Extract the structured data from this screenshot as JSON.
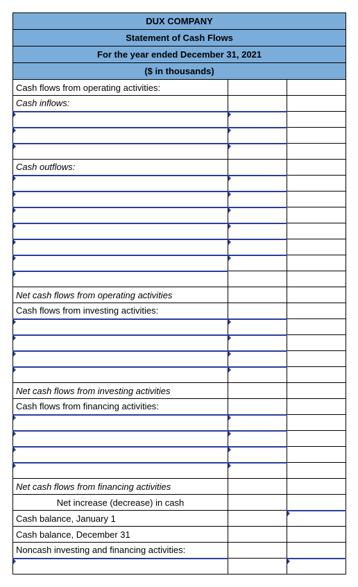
{
  "header": {
    "company": "DUX COMPANY",
    "title": "Statement of Cash Flows",
    "period": "For the year ended December 31, 2021",
    "units": "($ in thousands)"
  },
  "rows": [
    {
      "label": "Cash flows from operating activities:",
      "style": "",
      "c1": "plain",
      "c2": "plain"
    },
    {
      "label": "Cash inflows:",
      "style": "ital",
      "c1": "plain",
      "c2": "plain"
    },
    {
      "label": "",
      "style": "in indent-1",
      "c1": "in",
      "c2": "plain"
    },
    {
      "label": "",
      "style": "in indent-1",
      "c1": "in",
      "c2": "plain"
    },
    {
      "label": "",
      "style": "in indent-1",
      "c1": "in",
      "c2": "plain"
    },
    {
      "label": "Cash outflows:",
      "style": "ital",
      "c1": "plain",
      "c2": "plain"
    },
    {
      "label": "",
      "style": "in indent-1",
      "c1": "in",
      "c2": "plain"
    },
    {
      "label": "",
      "style": "in indent-1",
      "c1": "in",
      "c2": "plain"
    },
    {
      "label": "",
      "style": "in indent-1",
      "c1": "in",
      "c2": "plain"
    },
    {
      "label": "",
      "style": "in indent-1",
      "c1": "in",
      "c2": "plain"
    },
    {
      "label": "",
      "style": "in indent-1",
      "c1": "in",
      "c2": "plain"
    },
    {
      "label": "",
      "style": "in indent-1",
      "c1": "in",
      "c2": "plain"
    },
    {
      "label": "",
      "style": "in indent-1",
      "c1": "plain",
      "c2": "plain"
    },
    {
      "label": "Net cash flows from operating activities",
      "style": "ital",
      "c1": "plain",
      "c2": "plain"
    },
    {
      "label": "Cash flows from investing activities:",
      "style": "",
      "c1": "plain",
      "c2": "plain"
    },
    {
      "label": "",
      "style": "in indent-1",
      "c1": "in",
      "c2": "plain"
    },
    {
      "label": "",
      "style": "in indent-1",
      "c1": "in",
      "c2": "plain"
    },
    {
      "label": "",
      "style": "in indent-1",
      "c1": "in",
      "c2": "plain"
    },
    {
      "label": "",
      "style": "in indent-1",
      "c1": "in",
      "c2": "plain"
    },
    {
      "label": "Net cash flows from investing activities",
      "style": "ital",
      "c1": "plain",
      "c2": "plain"
    },
    {
      "label": "Cash flows from financing activities:",
      "style": "",
      "c1": "plain",
      "c2": "plain"
    },
    {
      "label": "",
      "style": "in indent-1",
      "c1": "in",
      "c2": "plain"
    },
    {
      "label": "",
      "style": "in indent-1",
      "c1": "in",
      "c2": "plain"
    },
    {
      "label": "",
      "style": "in indent-1",
      "c1": "in",
      "c2": "plain"
    },
    {
      "label": "",
      "style": "in indent-1",
      "c1": "in",
      "c2": "plain"
    },
    {
      "label": "Net cash flows from financing activities",
      "style": "ital",
      "c1": "plain",
      "c2": "plain"
    },
    {
      "label": "Net increase (decrease) in cash",
      "style": "indent-center",
      "c1": "plain",
      "c2": "plain"
    },
    {
      "label": "Cash balance, January 1",
      "style": "",
      "c1": "plain",
      "c2": "in"
    },
    {
      "label": "Cash balance, December 31",
      "style": "",
      "c1": "plain",
      "c2": "plain"
    },
    {
      "label": "Noncash investing and financing activities:",
      "style": "",
      "c1": "plain",
      "c2": "plain"
    },
    {
      "label": "",
      "style": "in indent-1",
      "c1": "plain",
      "c2": "in"
    }
  ]
}
